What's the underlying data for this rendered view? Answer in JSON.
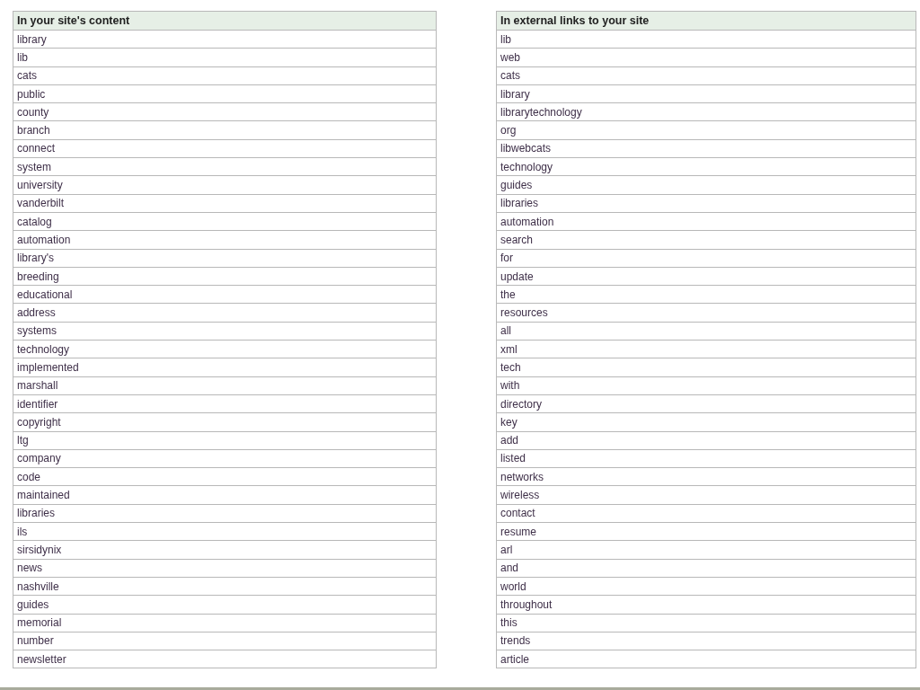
{
  "tables": [
    {
      "heading": "In your site's content",
      "rows": [
        "library",
        "lib",
        "cats",
        "public",
        "county",
        "branch",
        "connect",
        "system",
        "university",
        "vanderbilt",
        "catalog",
        "automation",
        "library's",
        "breeding",
        "educational",
        "address",
        "systems",
        "technology",
        "implemented",
        "marshall",
        "identifier",
        "copyright",
        "ltg",
        "company",
        "code",
        "maintained",
        "libraries",
        "ils",
        "sirsidynix",
        "news",
        "nashville",
        "guides",
        "memorial",
        "number",
        "newsletter"
      ]
    },
    {
      "heading": "In external links to your site",
      "rows": [
        "lib",
        "web",
        "cats",
        "library",
        "librarytechnology",
        "org",
        "libwebcats",
        "technology",
        "guides",
        "libraries",
        "automation",
        "search",
        "for",
        "update",
        "the",
        "resources",
        "all",
        "xml",
        "tech",
        "with",
        "directory",
        "key",
        "add",
        "listed",
        "networks",
        "wireless",
        "contact",
        "resume",
        "arl",
        "and",
        "world",
        "throughout",
        "this",
        "trends",
        "article"
      ]
    }
  ]
}
